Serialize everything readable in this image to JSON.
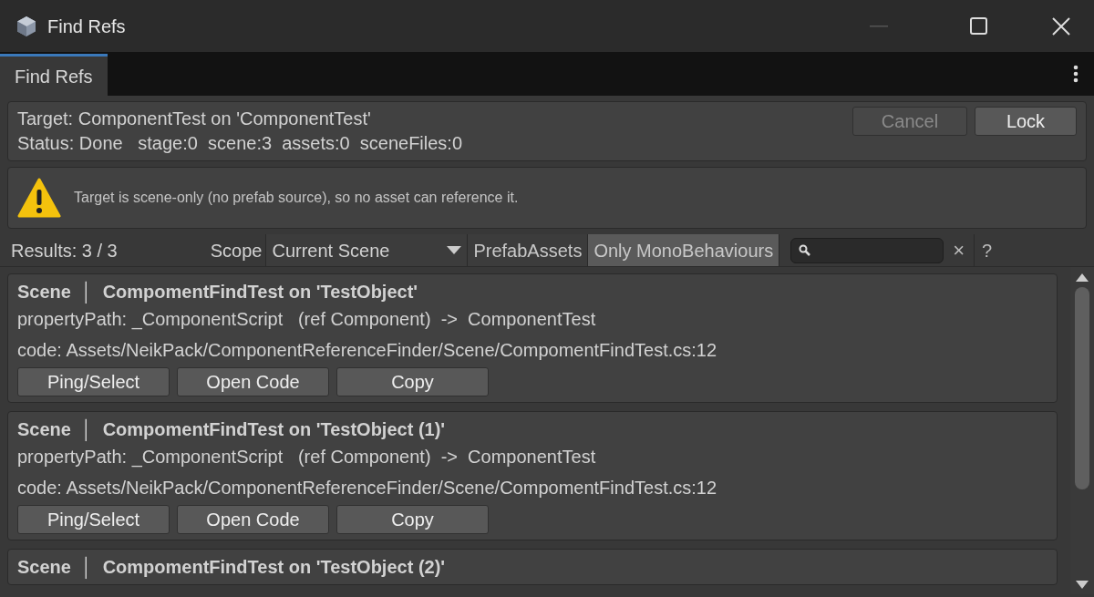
{
  "window": {
    "title": "Find Refs"
  },
  "tabs": [
    {
      "label": "Find Refs",
      "selected": true
    }
  ],
  "header": {
    "target": "Target: ComponentTest on 'ComponentTest'",
    "status": "Status: Done   stage:0  scene:3  assets:0  sceneFiles:0",
    "buttons": [
      {
        "label": "Cancel",
        "disabled": true
      },
      {
        "label": "Lock",
        "disabled": false
      }
    ]
  },
  "warning": {
    "text": "Target is scene-only (no prefab source), so no asset can reference it."
  },
  "toolbar": {
    "results": "Results: 3 / 3",
    "scope_label": "Scope",
    "scope_value": "Current Scene",
    "toggles": [
      {
        "label": "PrefabAssets",
        "selected": false
      },
      {
        "label": "Only MonoBehaviours",
        "selected": true
      }
    ],
    "clear": "×",
    "help": "?"
  },
  "results": [
    {
      "title": "Scene  │  CompomentFindTest on 'TestObject'",
      "property": "propertyPath: _ComponentScript   (ref Component)  ->  ComponentTest",
      "code": "code: Assets/NeikPack/ComponentReferenceFinder/Scene/CompomentFindTest.cs:12",
      "buttons": [
        "Ping/Select",
        "Open Code",
        "Copy"
      ]
    },
    {
      "title": "Scene  │  CompomentFindTest on 'TestObject (1)'",
      "property": "propertyPath: _ComponentScript   (ref Component)  ->  ComponentTest",
      "code": "code: Assets/NeikPack/ComponentReferenceFinder/Scene/CompomentFindTest.cs:12",
      "buttons": [
        "Ping/Select",
        "Open Code",
        "Copy"
      ]
    },
    {
      "title": "Scene  │  CompomentFindTest on 'TestObject (2)'"
    }
  ]
}
